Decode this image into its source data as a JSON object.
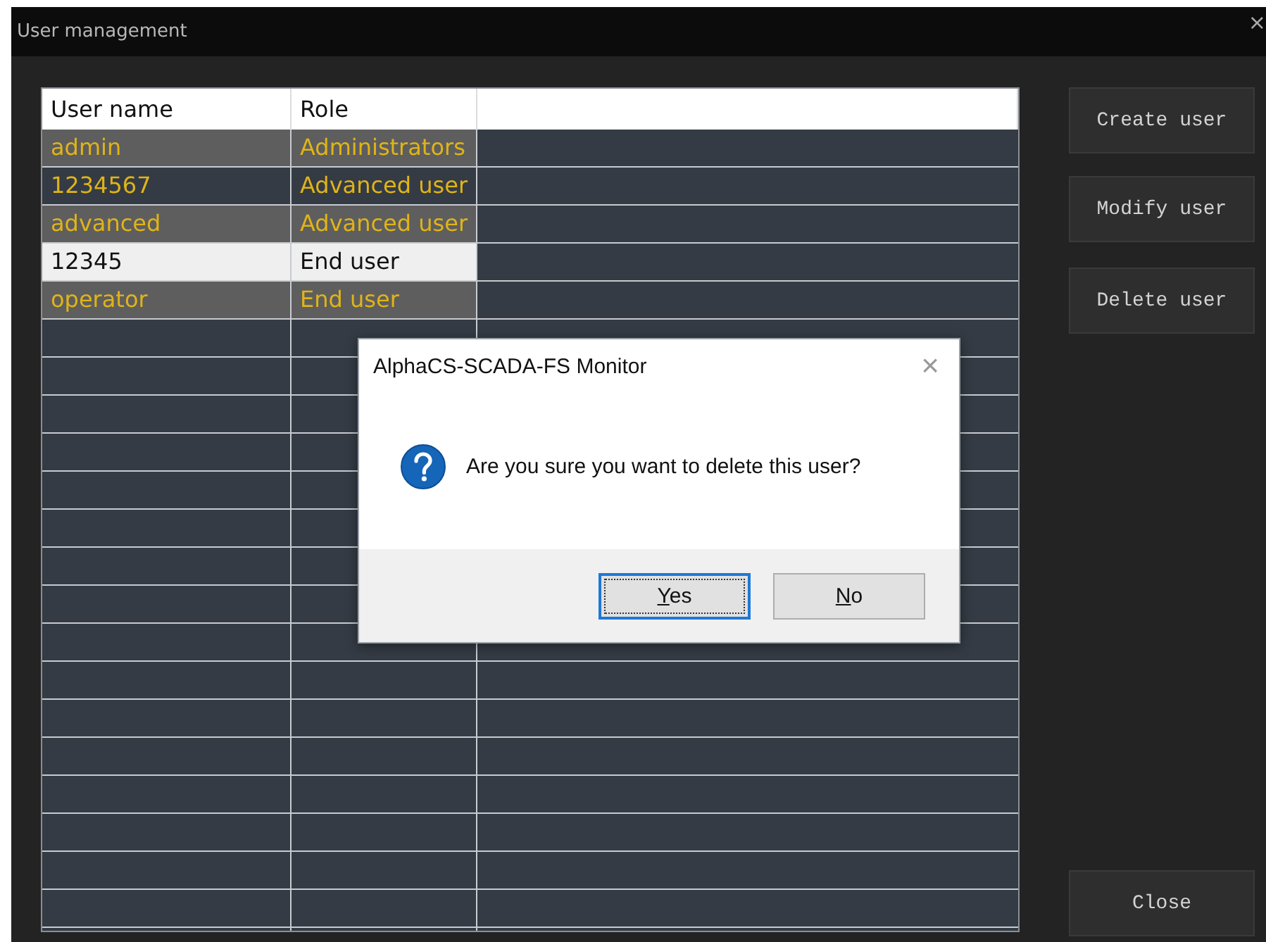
{
  "window": {
    "title": "User management",
    "close": "×"
  },
  "table": {
    "columns": [
      "User name",
      "Role"
    ],
    "rows": [
      {
        "cells": [
          "admin",
          "Administrators"
        ],
        "selected": false
      },
      {
        "cells": [
          "1234567",
          "Advanced user"
        ],
        "selected": false
      },
      {
        "cells": [
          "advanced",
          "Advanced user"
        ],
        "selected": false
      },
      {
        "cells": [
          "12345",
          "End user"
        ],
        "selected": true
      },
      {
        "cells": [
          "operator",
          "End user"
        ],
        "selected": false
      }
    ]
  },
  "actions": [
    "Create user",
    "Modify user",
    "Delete user"
  ],
  "close_button": "Close",
  "dialog": {
    "title": "AlphaCS-SCADA-FS Monitor",
    "close": "×",
    "message": "Are you sure you want to delete this user?",
    "buttons": [
      {
        "mnemonic": "Y",
        "label_rest": "es",
        "focused": true
      },
      {
        "mnemonic": "N",
        "label_rest": "o",
        "focused": false
      }
    ]
  }
}
